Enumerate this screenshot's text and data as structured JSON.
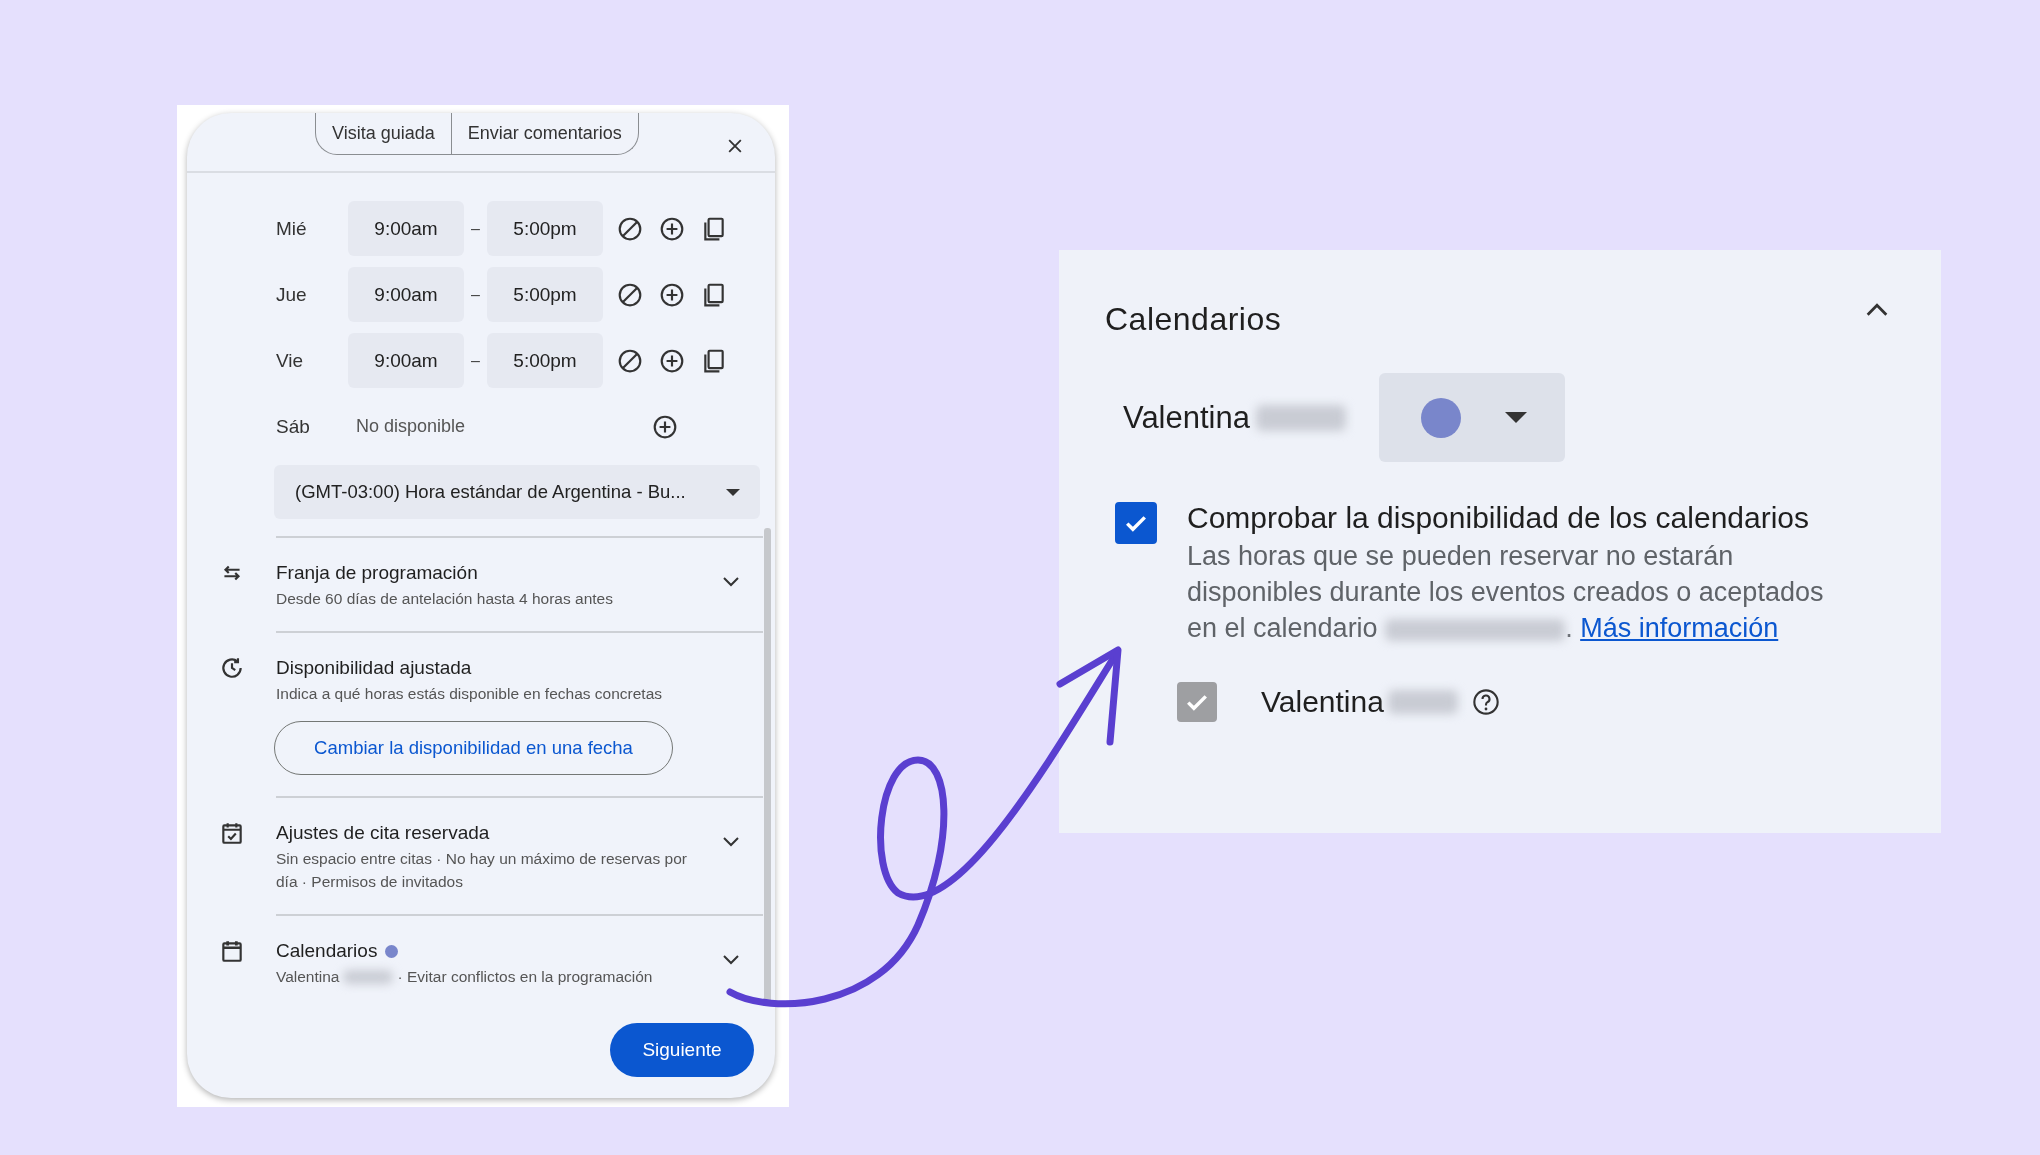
{
  "toolbar": {
    "tabs": [
      "Visita guiada",
      "Enviar comentarios"
    ]
  },
  "schedule": [
    {
      "day": "Mié",
      "kind": "hours",
      "start": "9:00am",
      "separator": "–",
      "end": "5:00pm"
    },
    {
      "day": "Jue",
      "kind": "hours",
      "start": "9:00am",
      "separator": "–",
      "end": "5:00pm"
    },
    {
      "day": "Vie",
      "kind": "hours",
      "start": "9:00am",
      "separator": "–",
      "end": "5:00pm"
    },
    {
      "day": "Sáb",
      "kind": "unavailable",
      "note": "No disponible"
    }
  ],
  "timezone": "(GMT-03:00) Hora estándar de Argentina - Bu...",
  "sections": [
    {
      "title": "Franja de programación",
      "subtitle": "Desde 60 días de antelación hasta 4 horas antes",
      "expanded": false
    },
    {
      "title": "Disponibilidad ajustada",
      "subtitle": "Indica a qué horas estás disponible en fechas concretas",
      "button": "Cambiar la disponibilidad en una fecha"
    },
    {
      "title": "Ajustes de cita reservada",
      "subtitle": "Sin espacio entre citas · No hay un máximo de reservas por día · Permisos de invitados",
      "expanded": false
    },
    {
      "title": "Calendarios",
      "color": "#7986cb",
      "subtitle_name": "Valentina",
      "subtitle": "· Evitar conflictos en la programación",
      "expanded": false
    }
  ],
  "next_button": "Siguiente",
  "detail": {
    "title": "Calendarios",
    "expanded": true,
    "calendar_name": "Valentina",
    "color": "#7986cb",
    "check": {
      "checked": true,
      "label": "Comprobar la disponibilidad de los calendarios",
      "description": "Las horas que se pueden reservar no estarán disponibles durante los eventos creados o aceptados en el calendario",
      "punctuation": ".",
      "link": "Más información"
    },
    "calendars": [
      {
        "name": "Valentina",
        "checked": true,
        "disabled": true
      }
    ]
  }
}
